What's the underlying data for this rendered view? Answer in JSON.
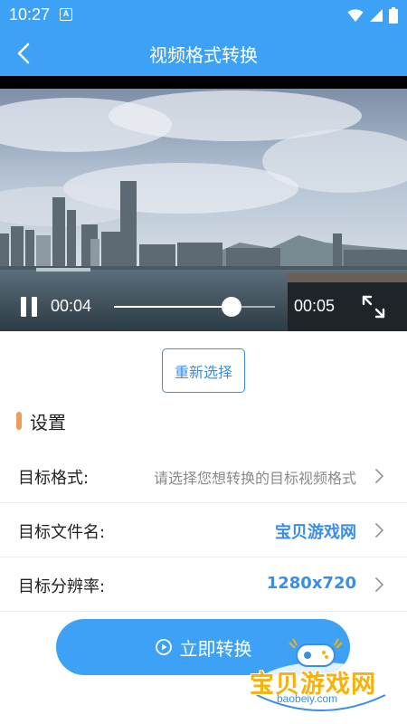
{
  "status_bar": {
    "time": "10:27",
    "notification_glyph": "A",
    "icons": [
      "wifi-icon",
      "signal-icon",
      "battery-icon"
    ]
  },
  "app_bar": {
    "title": "视频格式转换",
    "back_icon": "chevron-left-icon"
  },
  "video": {
    "current_time": "00:04",
    "total_time": "00:05",
    "progress": 0.73,
    "play_state_icon": "pause-icon",
    "fullscreen_icon": "fullscreen-icon"
  },
  "reselect_label": "重新选择",
  "settings": {
    "title": "设置",
    "rows": [
      {
        "label": "目标格式:",
        "value": "请选择您想转换的目标视频格式",
        "accent": false
      },
      {
        "label": "目标文件名:",
        "value": "宝贝游戏网",
        "accent": true
      },
      {
        "label": "目标分辨率:",
        "value": "1280x720",
        "accent": true
      }
    ]
  },
  "convert_label": "立即转换",
  "watermark": {
    "text": "宝贝游戏网",
    "url": "baobeiy.com"
  },
  "colors": {
    "primary": "#3da2f5",
    "accent_text": "#3a8ee8",
    "section_marker": "#f29a5a",
    "watermark": "#f6b20a"
  }
}
